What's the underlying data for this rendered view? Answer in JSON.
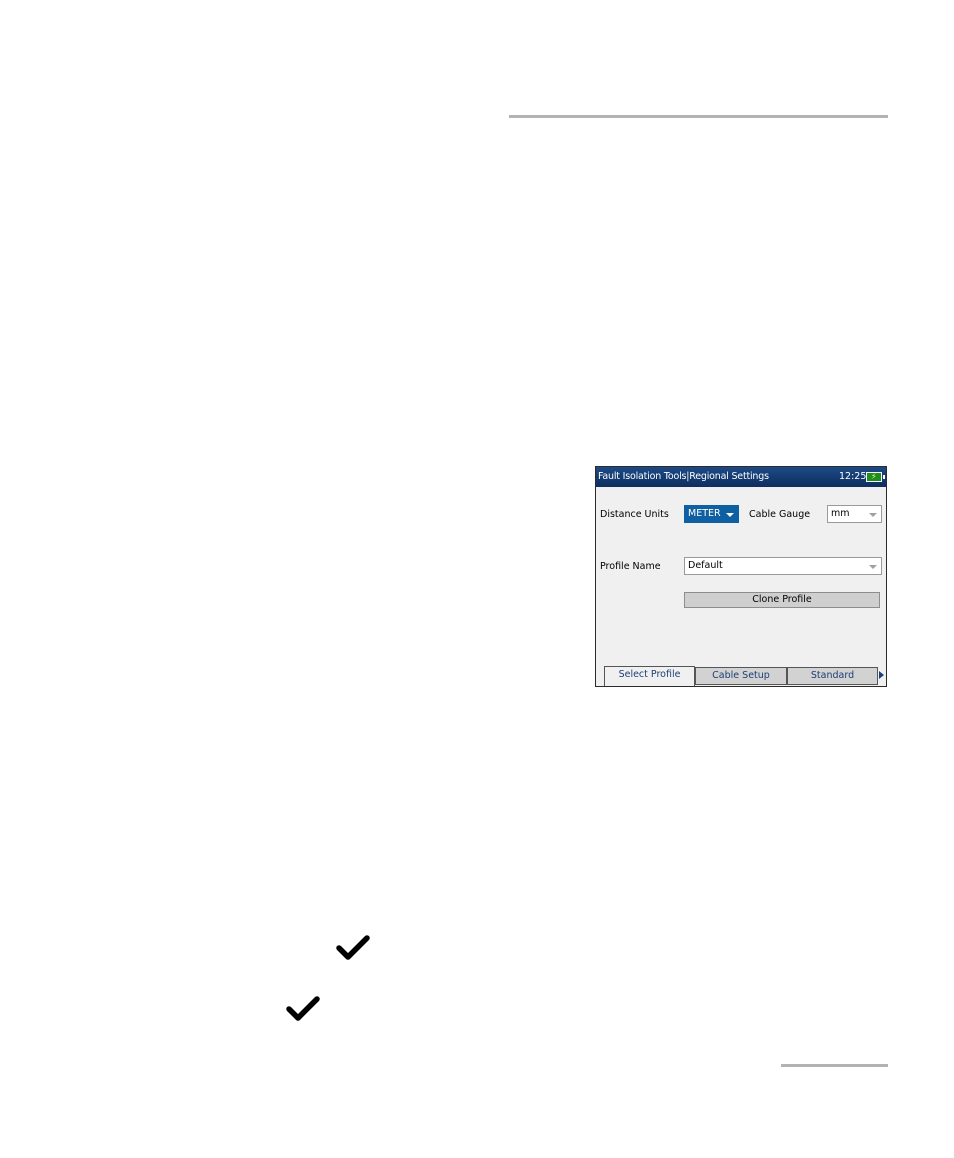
{
  "device": {
    "title": "Fault Isolation Tools|Regional Settings",
    "clock": "12:25",
    "distance_units_label": "Distance Units",
    "distance_units_value": "METER",
    "cable_gauge_label": "Cable Gauge",
    "cable_gauge_value": "mm",
    "profile_name_label": "Profile Name",
    "profile_name_value": "Default",
    "clone_button_label": "Clone Profile",
    "tabs": [
      {
        "label": "Select Profile",
        "selected": true
      },
      {
        "label": "Cable Setup",
        "selected": false
      },
      {
        "label": "Standard",
        "selected": false
      }
    ]
  },
  "icons": {
    "checkmarks": [
      "checkmark-icon",
      "checkmark-icon"
    ],
    "battery": "battery-icon",
    "tab_scroll": "chevron-right-icon"
  },
  "colors": {
    "titlebar": "#0e2e5e",
    "selected_dropdown": "#0f5fa3",
    "battery": "#1e8f1e",
    "rule": "#b3b3b3"
  }
}
